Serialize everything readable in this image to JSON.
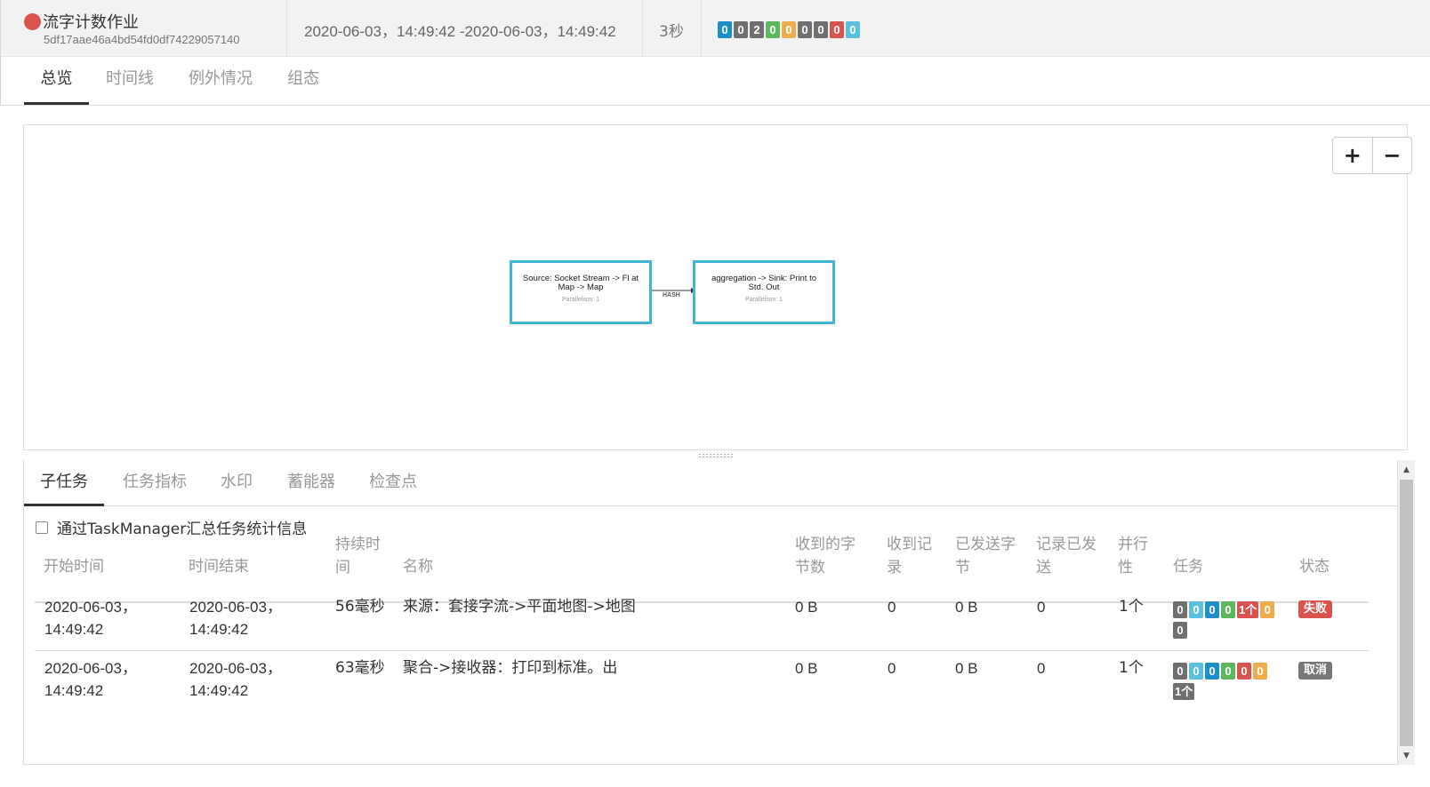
{
  "header": {
    "job_name": "流字计数作业",
    "job_id": "5df17aae46a4bd54fd0df74229057140",
    "time_range": "2020-06-03，14:49:42 -2020-06-03，14:49:42",
    "duration": "3秒",
    "counts": [
      {
        "value": "0",
        "color": "#1e8fc6"
      },
      {
        "value": "0",
        "color": "#6f6f6f"
      },
      {
        "value": "2",
        "color": "#6f6f6f"
      },
      {
        "value": "0",
        "color": "#5cb85c"
      },
      {
        "value": "0",
        "color": "#f0ad4e"
      },
      {
        "value": "0",
        "color": "#6f6f6f"
      },
      {
        "value": "0",
        "color": "#6f6f6f"
      },
      {
        "value": "0",
        "color": "#d9534f"
      },
      {
        "value": "0",
        "color": "#5bc0de"
      }
    ]
  },
  "top_tabs": [
    "总览",
    "时间线",
    "例外情况",
    "组态"
  ],
  "graph": {
    "zoom_in": "+",
    "zoom_out": "−",
    "nodes": [
      {
        "title": "Source: Socket Stream -> Fl at Map -> Map",
        "parallelism": "Parallelism: 1"
      },
      {
        "title": "aggregation -> Sink: Print to Std. Out",
        "parallelism": "Parallelism: 1"
      }
    ],
    "edge_label": "HASH"
  },
  "sub_tabs": [
    "子任务",
    "任务指标",
    "水印",
    "蓄能器",
    "检查点"
  ],
  "aggregate_checkbox": {
    "label": "通过TaskManager汇总任务统计信息",
    "checked": false
  },
  "table": {
    "headers": {
      "start": "开始时间",
      "end": "时间结束",
      "duration_1": "持续时",
      "duration_2": "间",
      "name": "名称",
      "bytes_recv_1": "收到的字",
      "bytes_recv_2": "节数",
      "rec_recv_1": "收到记",
      "rec_recv_2": "录",
      "bytes_sent_1": "已发送字",
      "bytes_sent_2": "节",
      "rec_sent_1": "记录已发",
      "rec_sent_2": "送",
      "par_1": "并行",
      "par_2": "性",
      "tasks": "任务",
      "status": "状态"
    },
    "rows": [
      {
        "start_1": "2020-06-03，",
        "start_2": "14:49:42",
        "end_1": "2020-06-03，",
        "end_2": "14:49:42",
        "duration": "56毫秒",
        "name": "来源：套接字流->平面地图->地图",
        "bytes_recv": "0 B",
        "rec_recv": "0",
        "bytes_sent": "0 B",
        "rec_sent": "0",
        "parallelism": "1个",
        "tasks": [
          {
            "value": "0",
            "color": "#6f6f6f"
          },
          {
            "value": "0",
            "color": "#5bc0de"
          },
          {
            "value": "0",
            "color": "#1e8fc6"
          },
          {
            "value": "0",
            "color": "#5cb85c"
          },
          {
            "value": "1个",
            "color": "#d9534f"
          },
          {
            "value": "0",
            "color": "#f0ad4e"
          },
          {
            "value": "0",
            "color": "#6f6f6f"
          }
        ],
        "status": "失败",
        "status_color": "#d9534f"
      },
      {
        "start_1": "2020-06-03，",
        "start_2": "14:49:42",
        "end_1": "2020-06-03，",
        "end_2": "14:49:42",
        "duration": "63毫秒",
        "name": "聚合->接收器：打印到标准。出",
        "bytes_recv": "0 B",
        "rec_recv": "0",
        "bytes_sent": "0 B",
        "rec_sent": "0",
        "parallelism": "1个",
        "tasks": [
          {
            "value": "0",
            "color": "#6f6f6f"
          },
          {
            "value": "0",
            "color": "#5bc0de"
          },
          {
            "value": "0",
            "color": "#1e8fc6"
          },
          {
            "value": "0",
            "color": "#5cb85c"
          },
          {
            "value": "0",
            "color": "#d9534f"
          },
          {
            "value": "0",
            "color": "#f0ad4e"
          },
          {
            "value": "1个",
            "color": "#6f6f6f"
          }
        ],
        "status": "取消",
        "status_color": "#777777"
      }
    ]
  }
}
